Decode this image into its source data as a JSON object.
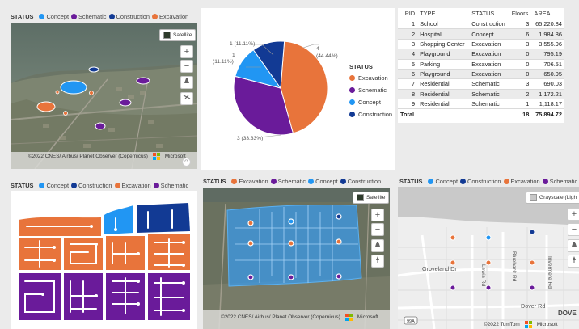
{
  "colors": {
    "excavation": "#e8743b",
    "schematic": "#6a1b9a",
    "concept": "#2196f3",
    "construction": "#123a94"
  },
  "status_label": "STATUS",
  "map_tl": {
    "legend": [
      "Concept",
      "Schematic",
      "Construction",
      "Excavation"
    ],
    "style_button": "Satellite",
    "attribution": "©2022 CNES/ Airbus/ Planet Observer (Copernicus)",
    "brand": "Microsoft",
    "zoom_in": "+",
    "zoom_out": "−"
  },
  "pie": {
    "legend_title": "STATUS",
    "legend": [
      "Excavation",
      "Schematic",
      "Concept",
      "Construction"
    ],
    "labels": {
      "excavation_value": "4",
      "excavation_pct": "(44.44%)",
      "schematic": "3 (33.33%)",
      "concept_value": "1",
      "concept_pct": "(11.11%)",
      "construction": "1 (11.11%)"
    }
  },
  "chart_data": {
    "type": "pie",
    "categories": [
      "Excavation",
      "Schematic",
      "Concept",
      "Construction"
    ],
    "values": [
      4,
      3,
      1,
      1
    ],
    "percentages": [
      44.44,
      33.33,
      11.11,
      11.11
    ],
    "legend_title": "STATUS"
  },
  "table": {
    "columns": [
      "PID",
      "TYPE",
      "STATUS",
      "Floors",
      "AREA"
    ],
    "rows": [
      [
        "1",
        "School",
        "Construction",
        "3",
        "65,220.84"
      ],
      [
        "2",
        "Hospital",
        "Concept",
        "6",
        "1,984.86"
      ],
      [
        "3",
        "Shopping Center",
        "Excavation",
        "3",
        "3,555.96"
      ],
      [
        "4",
        "Playground",
        "Excavation",
        "0",
        "795.19"
      ],
      [
        "5",
        "Parking",
        "Excavation",
        "0",
        "706.51"
      ],
      [
        "6",
        "Playground",
        "Excavation",
        "0",
        "650.95"
      ],
      [
        "7",
        "Residential",
        "Schematic",
        "3",
        "690.03"
      ],
      [
        "8",
        "Residential",
        "Schematic",
        "2",
        "1,172.21"
      ],
      [
        "9",
        "Residential",
        "Schematic",
        "1",
        "1,118.17"
      ]
    ],
    "total": {
      "label": "Total",
      "floors": "18",
      "area": "75,894.72"
    }
  },
  "shape_map": {
    "legend": [
      "Concept",
      "Construction",
      "Excavation",
      "Schematic"
    ]
  },
  "map_bc": {
    "legend": [
      "Excavation",
      "Schematic",
      "Concept",
      "Construction"
    ],
    "style_button": "Satellite",
    "attribution": "©2022 CNES/ Airbus/ Planet Observer (Copernicus)",
    "brand": "Microsoft"
  },
  "map_br": {
    "legend": [
      "Concept",
      "Construction",
      "Excavation",
      "Schematic"
    ],
    "style_button": "Grayscale (Ligh",
    "streets": [
      "Groveland Dr",
      "Lewis Rd",
      "Blueback Rd",
      "Invermere Rd",
      "Dover Rd",
      "DOVE"
    ],
    "route": "99A",
    "attribution": "©2022 TomTom",
    "brand": "Microsoft"
  }
}
